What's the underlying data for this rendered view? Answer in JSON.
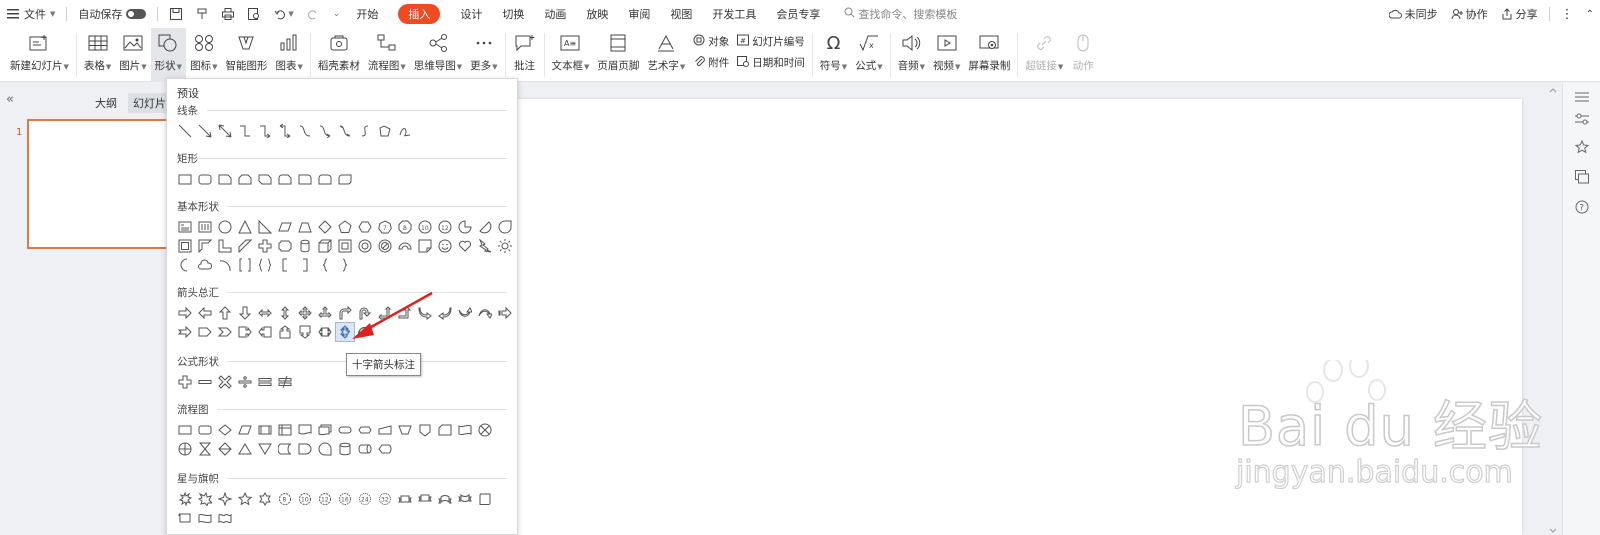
{
  "menubar": {
    "file": "文件",
    "autosave": "自动保存",
    "tabs": [
      "开始",
      "插入",
      "设计",
      "切换",
      "动画",
      "放映",
      "审阅",
      "视图",
      "开发工具",
      "会员专享"
    ],
    "active_tab": "插入",
    "search_placeholder": "查找命令、搜索模板",
    "sync": "未同步",
    "collab": "协作",
    "share": "分享"
  },
  "ribbon": {
    "new_slide": "新建幻灯片",
    "table": "表格",
    "picture": "图片",
    "shape": "形状",
    "icon": "图标",
    "smartart": "智能图形",
    "chart": "图表",
    "material": "稻壳素材",
    "flowchart": "流程图",
    "mindmap": "思维导图",
    "more": "更多",
    "comment": "批注",
    "textbox": "文本框",
    "header_footer": "页眉页脚",
    "wordart": "艺术字",
    "object": "对象",
    "attachment": "附件",
    "slide_number": "幻灯片编号",
    "date_time": "日期和时间",
    "symbol": "符号",
    "formula": "公式",
    "audio": "音频",
    "video": "视频",
    "screen_record": "屏幕录制",
    "hyperlink": "超链接",
    "action": "动作"
  },
  "leftpane": {
    "outline": "大纲",
    "slides": "幻灯片",
    "slide_number": "1"
  },
  "dropdown": {
    "preset": "预设",
    "sections": {
      "lines": "线条",
      "rect": "矩形",
      "basic": "基本形状",
      "arrows": "箭头总汇",
      "formula": "公式形状",
      "flow": "流程图",
      "stars": "星与旗帜"
    }
  },
  "tooltip": "十字箭头标注",
  "watermark": {
    "line1": "Bai du 经验",
    "line2": "jingyan.baidu.com"
  }
}
